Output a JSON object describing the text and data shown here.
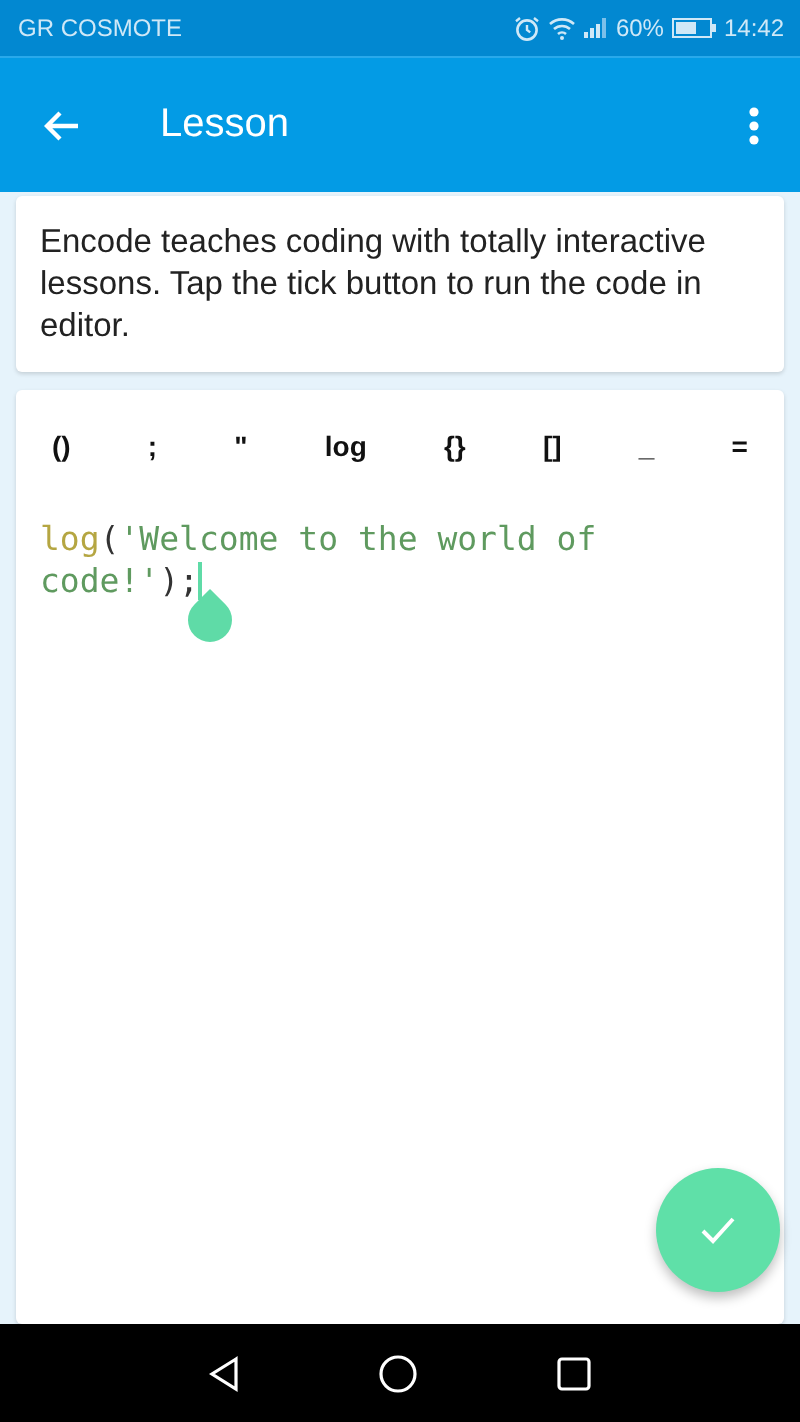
{
  "status_bar": {
    "carrier": "GR COSMOTE",
    "battery": "60%",
    "time": "14:42"
  },
  "app_bar": {
    "title": "Lesson"
  },
  "intro": "Encode teaches coding with totally interactive lessons. Tap the tick button to run the code in editor.",
  "editor": {
    "keys": [
      "()",
      ";",
      "\"",
      "log",
      "{}",
      "[]",
      "_",
      "="
    ],
    "code": [
      {
        "kind": "function",
        "text": "log"
      },
      {
        "kind": "punct",
        "text": "("
      },
      {
        "kind": "string",
        "text": "'Welcome to the world of code!'"
      },
      {
        "kind": "punct",
        "text": ");"
      }
    ]
  }
}
